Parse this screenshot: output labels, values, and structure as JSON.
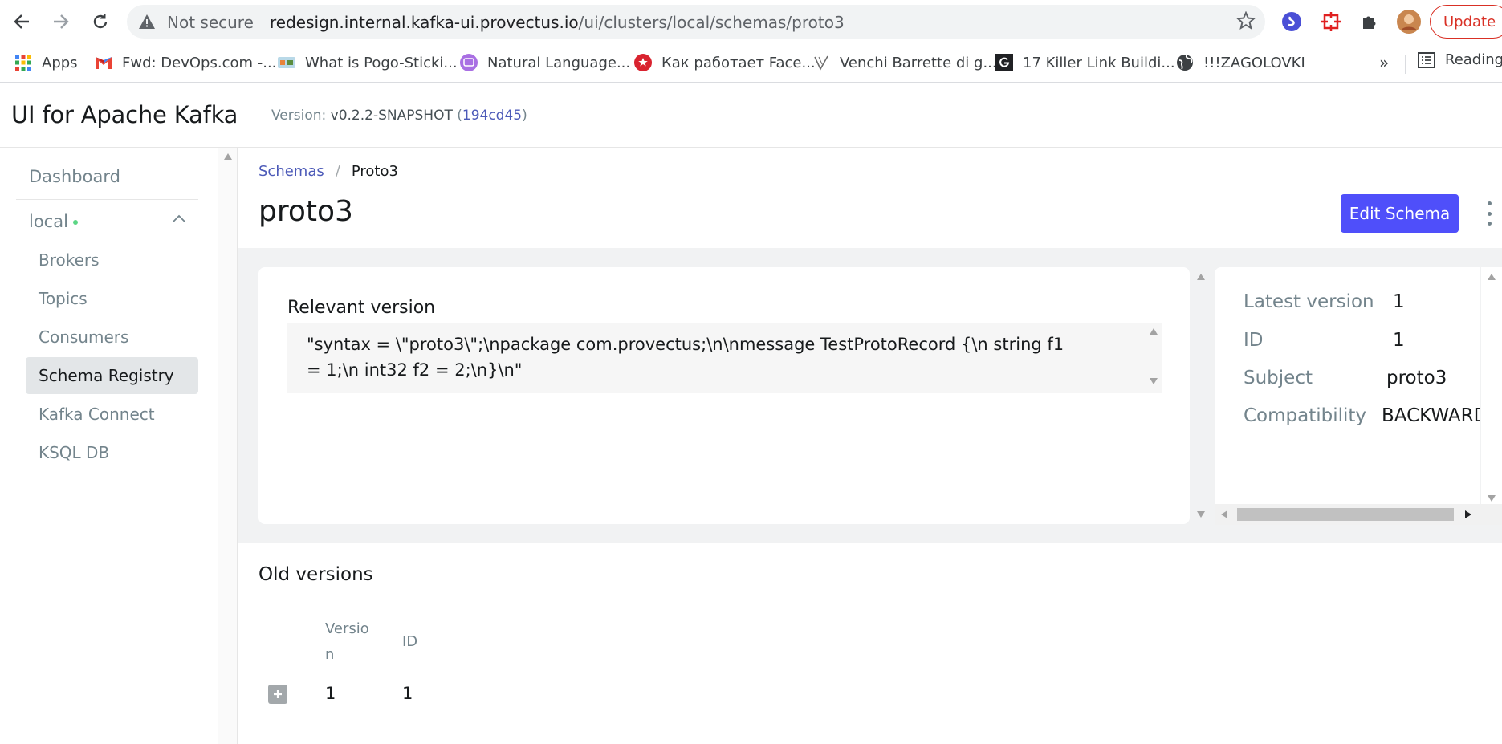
{
  "browser": {
    "not_secure": "Not secure",
    "url_host": "redesign.internal.kafka-ui.provectus.io",
    "url_path": "/ui/clusters/local/schemas/proto3",
    "update_label": "Update",
    "bookmarks": [
      {
        "label": "Apps",
        "icon": "apps-grid-icon"
      },
      {
        "label": "Fwd: DevOps.com -...",
        "icon": "gmail-icon"
      },
      {
        "label": "What is Pogo-Sticki...",
        "icon": "pogo-icon"
      },
      {
        "label": "Natural Language...",
        "icon": "natural-language-icon"
      },
      {
        "label": "Как работает Face...",
        "icon": "red-star-icon"
      },
      {
        "label": "Venchi Barrette di g...",
        "icon": "venchi-icon"
      },
      {
        "label": "17 Killer Link Buildi...",
        "icon": "g-letter-icon"
      },
      {
        "label": "!!!ZAGOLOVKI",
        "icon": "globe-icon"
      }
    ],
    "more_label": "»",
    "reading_label": "Reading"
  },
  "app": {
    "title": "UI for Apache Kafka",
    "version_prefix": "Version: ",
    "version_number": "v0.2.2-SNAPSHOT",
    "commit": "194cd45"
  },
  "sidebar": {
    "dashboard": "Dashboard",
    "cluster": "local",
    "items": [
      "Brokers",
      "Topics",
      "Consumers",
      "Schema Registry",
      "Kafka Connect",
      "KSQL DB"
    ],
    "active": "Schema Registry"
  },
  "main": {
    "breadcrumb": {
      "parent": "Schemas",
      "separator": "/",
      "current": "Proto3"
    },
    "title": "proto3",
    "edit_button": "Edit Schema",
    "relevant_label": "Relevant version",
    "schema_line1": "\"syntax = \\\"proto3\\\";\\npackage com.provectus;\\n\\nmessage TestProtoRecord {\\n string f1",
    "schema_line2": "= 1;\\n int32 f2 = 2;\\n}\\n\"",
    "info": {
      "latest_version_label": "Latest version",
      "latest_version": "1",
      "id_label": "ID",
      "id": "1",
      "subject_label": "Subject",
      "subject": "proto3",
      "compatibility_label": "Compatibility",
      "compatibility": "BACKWARD"
    },
    "old_versions": {
      "title": "Old versions",
      "headers": {
        "version_line1": "Versio",
        "version_line2": "n",
        "id": "ID"
      },
      "rows": [
        {
          "version": "1",
          "id": "1"
        }
      ]
    }
  },
  "colors": {
    "accent": "#4f4ffa",
    "link": "#4c5ab8",
    "online": "#5cd685"
  }
}
